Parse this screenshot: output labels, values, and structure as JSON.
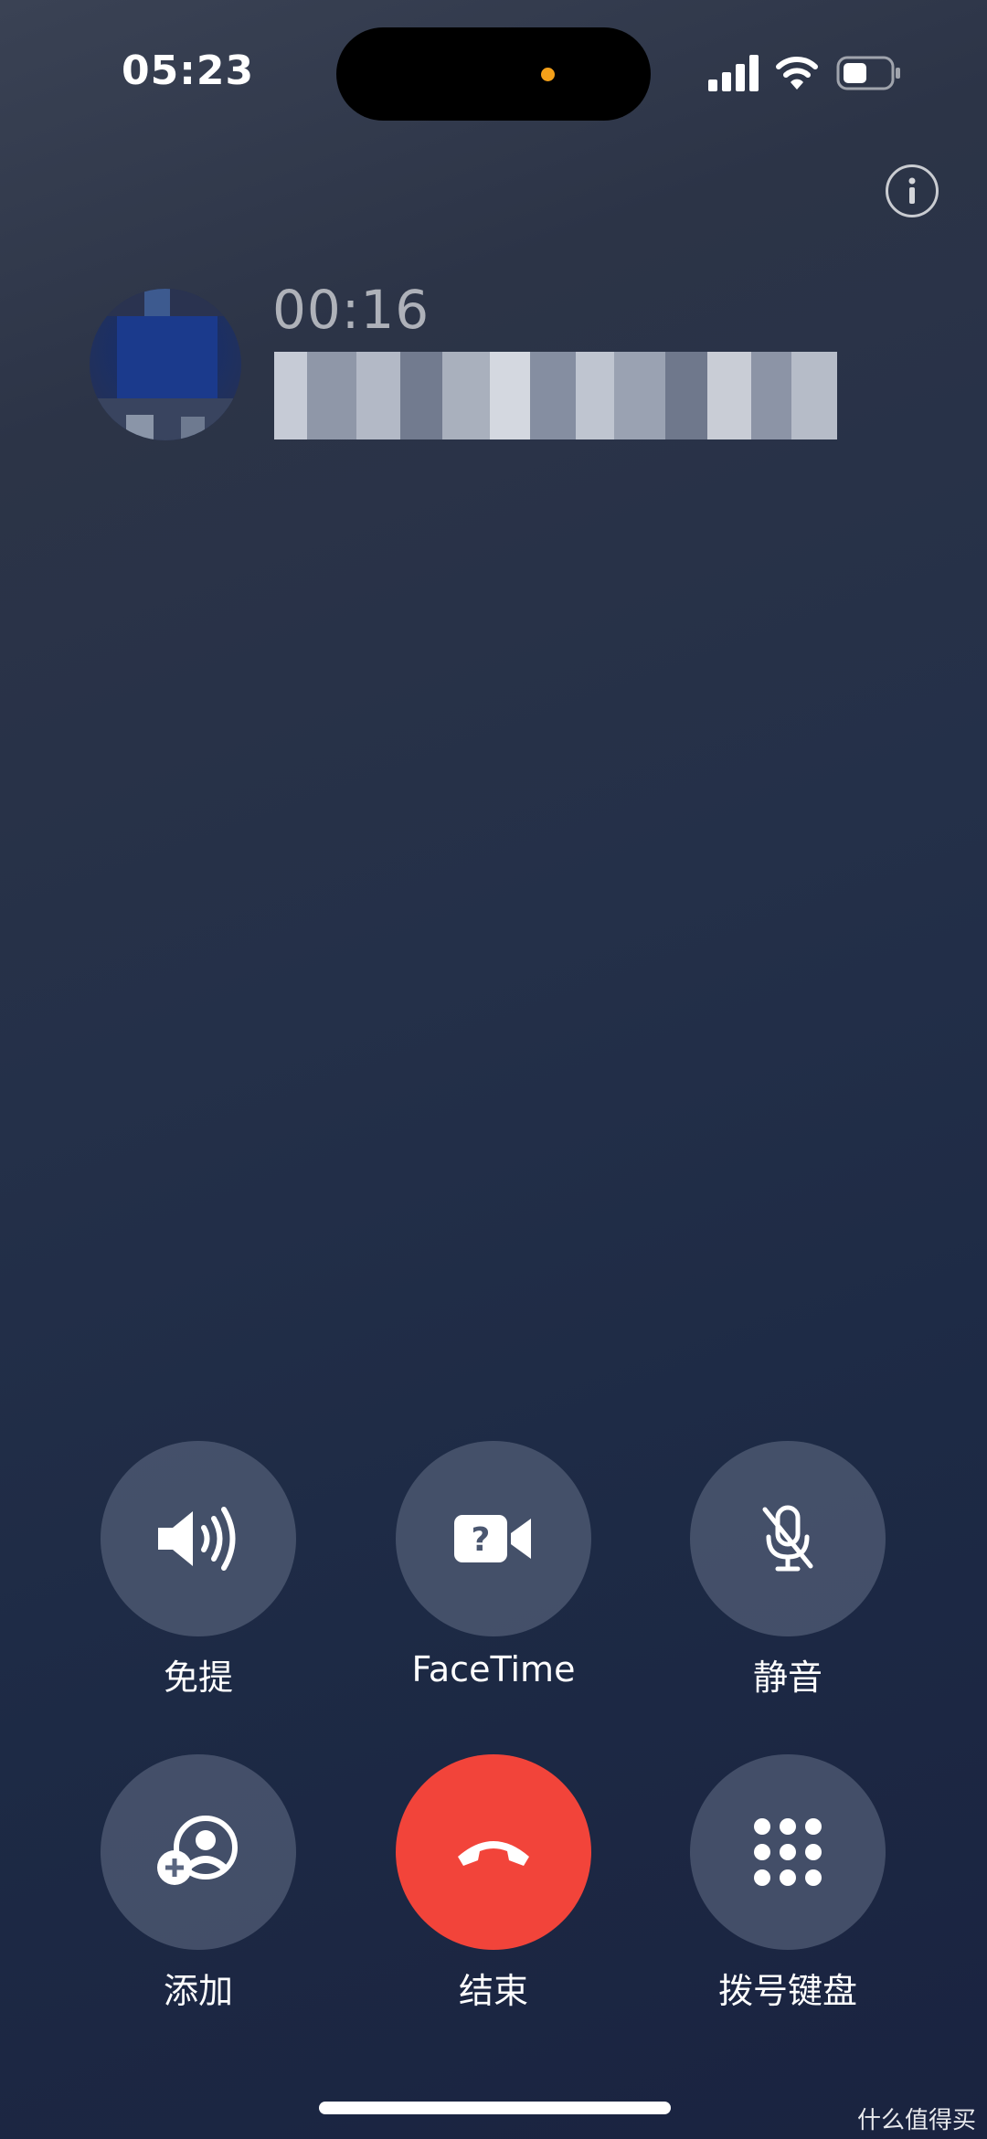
{
  "status_bar": {
    "time": "05:23"
  },
  "call": {
    "duration": "00:16"
  },
  "controls": {
    "speaker": "免提",
    "facetime": "FaceTime",
    "mute": "静音",
    "add": "添加",
    "end": "结束",
    "keypad": "拨号键盘"
  },
  "watermark": "什么值得买",
  "colors": {
    "end_call": "#f2443a",
    "button_bg": "#5c6880",
    "privacy_dot": "#f4a019"
  }
}
